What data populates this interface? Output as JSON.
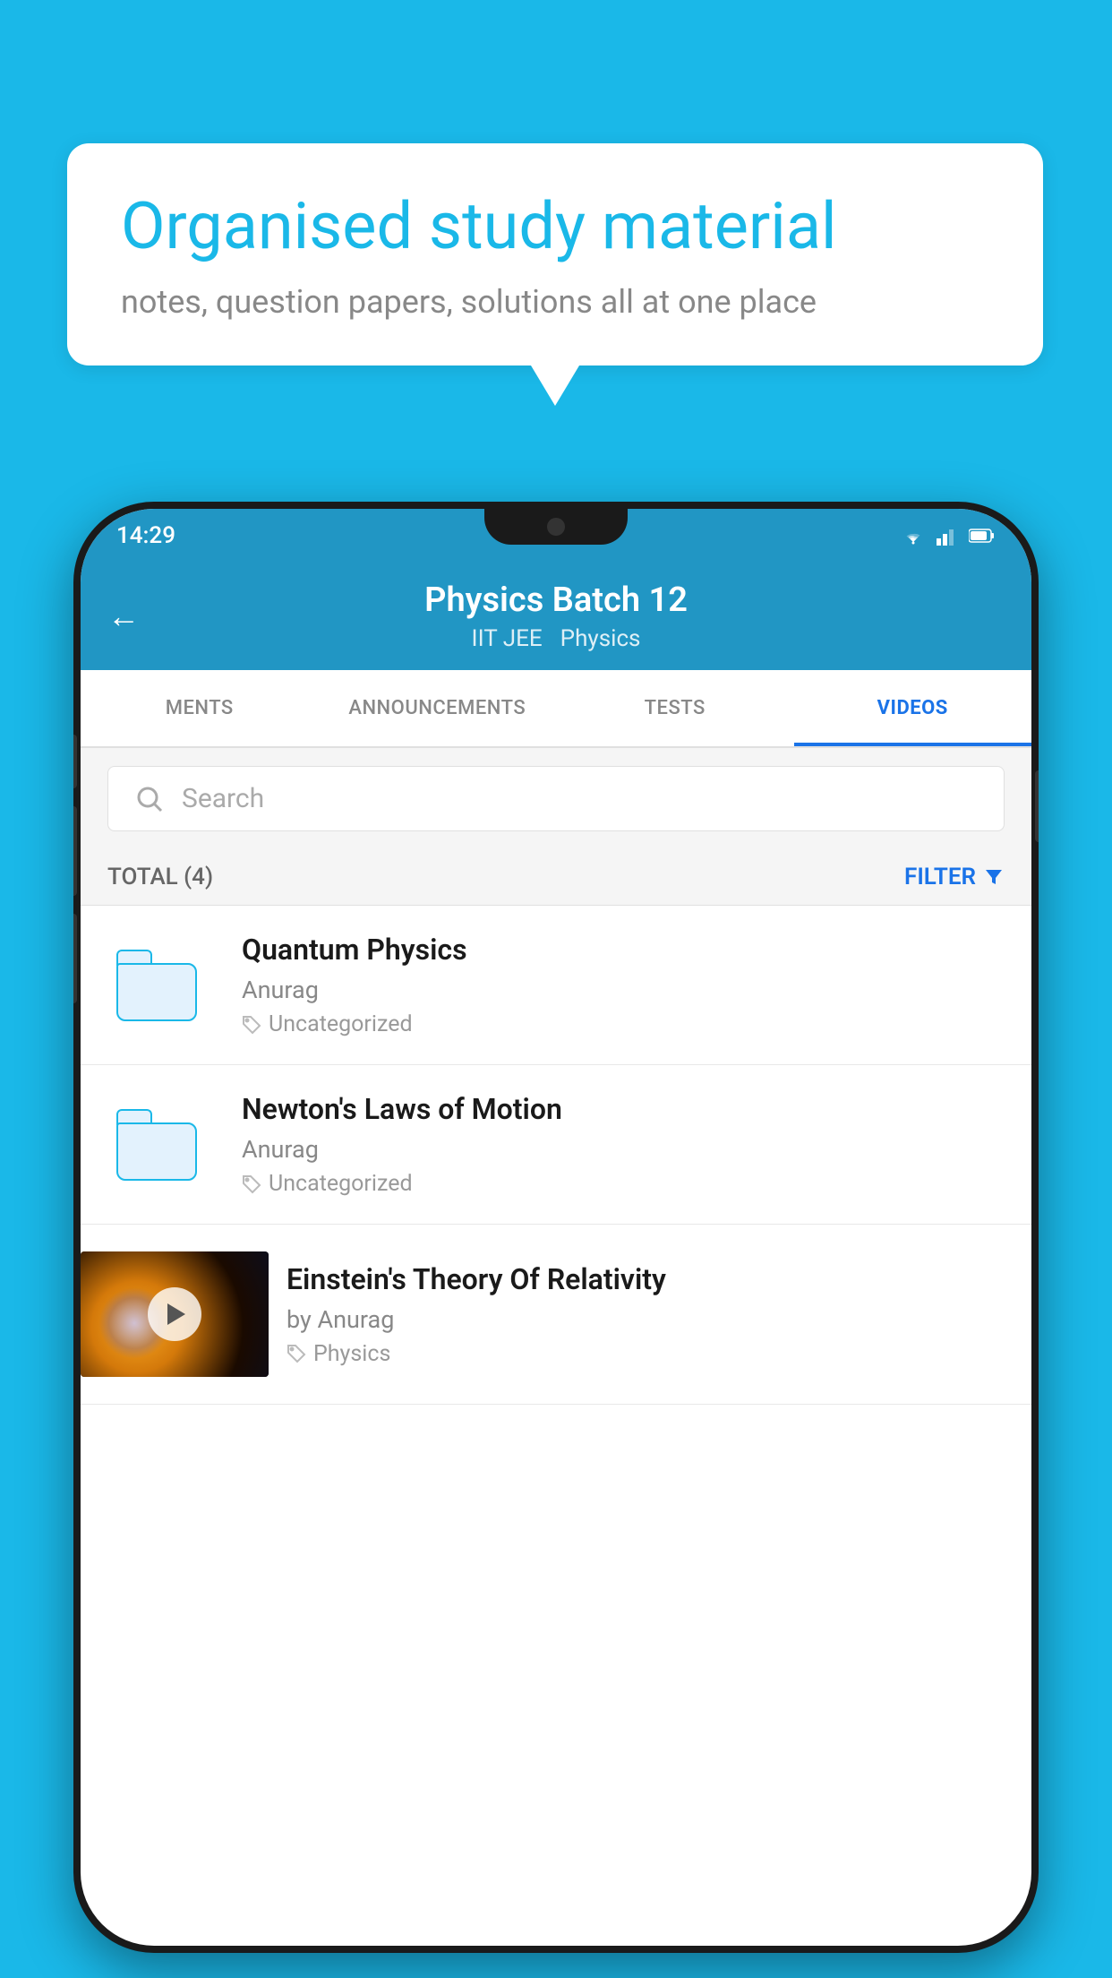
{
  "background_color": "#1ab8e8",
  "bubble": {
    "title": "Organised study material",
    "subtitle": "notes, question papers, solutions all at one place"
  },
  "phone": {
    "status_bar": {
      "time": "14:29",
      "icons": [
        "wifi",
        "signal",
        "battery"
      ]
    },
    "header": {
      "back_label": "←",
      "title": "Physics Batch 12",
      "tags": [
        "IIT JEE",
        "Physics"
      ]
    },
    "tabs": [
      {
        "label": "MENTS",
        "active": false
      },
      {
        "label": "ANNOUNCEMENTS",
        "active": false
      },
      {
        "label": "TESTS",
        "active": false
      },
      {
        "label": "VIDEOS",
        "active": true
      }
    ],
    "search": {
      "placeholder": "Search"
    },
    "filter_bar": {
      "total_label": "TOTAL (4)",
      "filter_label": "FILTER"
    },
    "videos": [
      {
        "id": 1,
        "title": "Quantum Physics",
        "author": "Anurag",
        "tag": "Uncategorized",
        "type": "folder",
        "has_thumb": false
      },
      {
        "id": 2,
        "title": "Newton's Laws of Motion",
        "author": "Anurag",
        "tag": "Uncategorized",
        "type": "folder",
        "has_thumb": false
      },
      {
        "id": 3,
        "title": "Einstein's Theory Of Relativity",
        "author": "by Anurag",
        "tag": "Physics",
        "type": "video",
        "has_thumb": true
      }
    ]
  }
}
